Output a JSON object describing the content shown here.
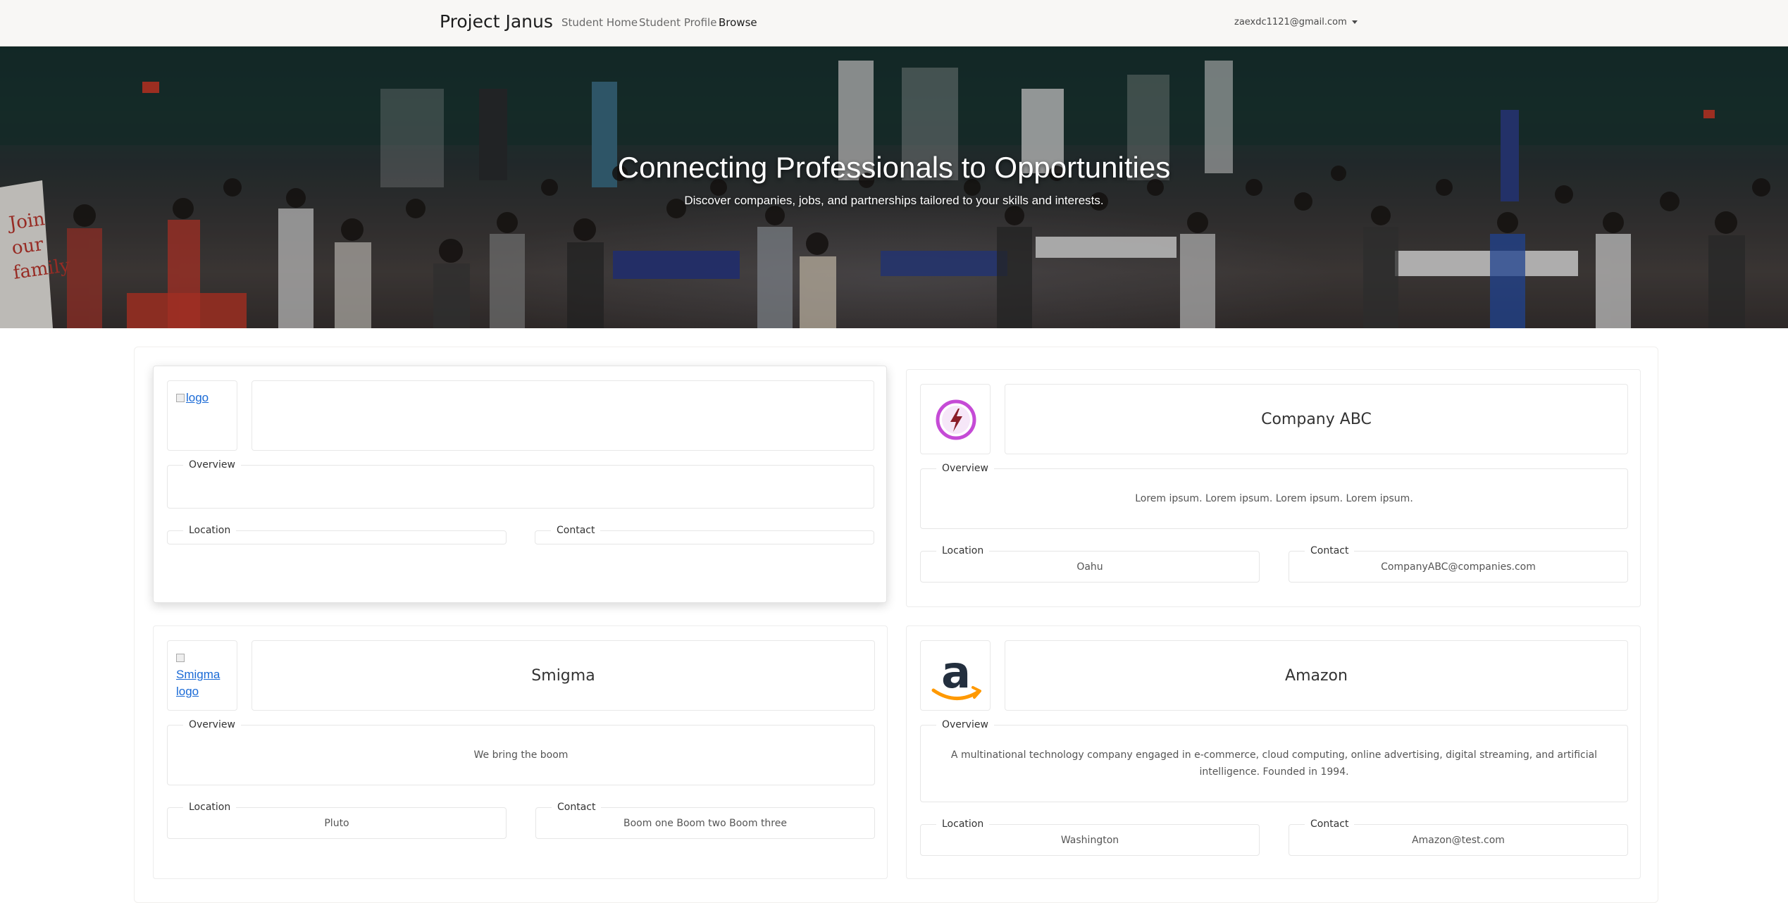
{
  "navbar": {
    "brand": "Project Janus",
    "links": [
      {
        "label": "Student Home"
      },
      {
        "label": "Student Profile"
      },
      {
        "label": "Browse"
      }
    ],
    "user_email": "zaexdc1121@gmail.com"
  },
  "hero": {
    "title": "Connecting Professionals to Opportunities",
    "subtitle": "Discover companies, jobs, and partnerships tailored to your skills and interests."
  },
  "labels": {
    "overview": "Overview",
    "location": "Location",
    "contact": "Contact"
  },
  "companies": [
    {
      "logo_alt": "logo",
      "name": "",
      "overview": "",
      "location": "",
      "contact": ""
    },
    {
      "logo_icon": "lightning-bolt-circle-icon",
      "name": "Company ABC",
      "overview": "Lorem ipsum. Lorem ipsum. Lorem ipsum. Lorem ipsum.",
      "location": "Oahu",
      "contact": "CompanyABC@companies.com"
    },
    {
      "logo_alt": "Smigma logo",
      "name": "Smigma",
      "overview": "We bring the boom",
      "location": "Pluto",
      "contact": "Boom one Boom two Boom three"
    },
    {
      "logo_icon": "amazon-logo-icon",
      "name": "Amazon",
      "overview": "A multinational technology company engaged in e-commerce, cloud computing, online advertising, digital streaming, and artificial intelligence. Founded in 1994.",
      "location": "Washington",
      "contact": "Amazon@test.com"
    }
  ],
  "colors": {
    "navbar_bg": "#f8f7f5",
    "link": "#1a6ad6",
    "amazon_orange": "#ff9900",
    "bolt_purple": "#c54bd6"
  }
}
